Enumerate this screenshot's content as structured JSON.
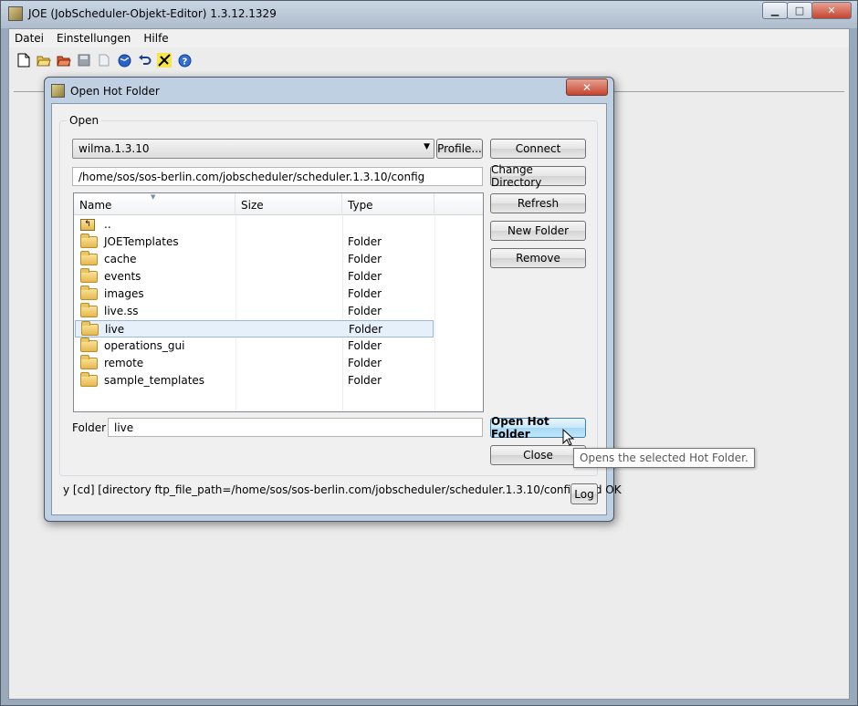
{
  "window": {
    "title": "JOE (JobScheduler-Objekt-Editor) 1.3.12.1329",
    "controls": {
      "minimize": "▁",
      "maximize": "□",
      "close": "✕"
    }
  },
  "menubar": {
    "items": [
      "Datei",
      "Einstellungen",
      "Hilfe"
    ]
  },
  "toolbar": {
    "icons": [
      "new-file-icon",
      "open-file-icon",
      "open-folder-icon",
      "save-icon",
      "save-as-icon",
      "globe-icon",
      "undo-icon",
      "wizard-icon",
      "help-icon"
    ]
  },
  "dialog": {
    "title": "Open Hot Folder",
    "close_glyph": "✕",
    "group_label": "Open",
    "profile": {
      "selected": "wilma.1.3.10",
      "button": "Profile..."
    },
    "path": "/home/sos/sos-berlin.com/jobscheduler/scheduler.1.3.10/config",
    "buttons": {
      "connect": "Connect",
      "change_directory": "Change Directory",
      "refresh": "Refresh",
      "new_folder": "New Folder",
      "remove": "Remove",
      "open_hot_folder": "Open Hot Folder",
      "close": "Close",
      "log": "Log"
    },
    "columns": {
      "name": "Name",
      "size": "Size",
      "type": "Type"
    },
    "rows": [
      {
        "name": "..",
        "size": "",
        "type": ""
      },
      {
        "name": "JOETemplates",
        "size": "",
        "type": "Folder"
      },
      {
        "name": "cache",
        "size": "",
        "type": "Folder"
      },
      {
        "name": "events",
        "size": "",
        "type": "Folder"
      },
      {
        "name": "images",
        "size": "",
        "type": "Folder"
      },
      {
        "name": "live.ss",
        "size": "",
        "type": "Folder"
      },
      {
        "name": "live",
        "size": "",
        "type": "Folder"
      },
      {
        "name": "operations_gui",
        "size": "",
        "type": "Folder"
      },
      {
        "name": "remote",
        "size": "",
        "type": "Folder"
      },
      {
        "name": "sample_templates",
        "size": "",
        "type": "Folder"
      }
    ],
    "selected_row": 6,
    "folder": {
      "label": "Folder",
      "value": "live"
    },
    "status": "y [cd] [directory ftp_file_path=/home/sos/sos-berlin.com/jobscheduler/scheduler.1.3.10/config]: cd OK",
    "tooltip": "Opens the selected Hot Folder."
  }
}
